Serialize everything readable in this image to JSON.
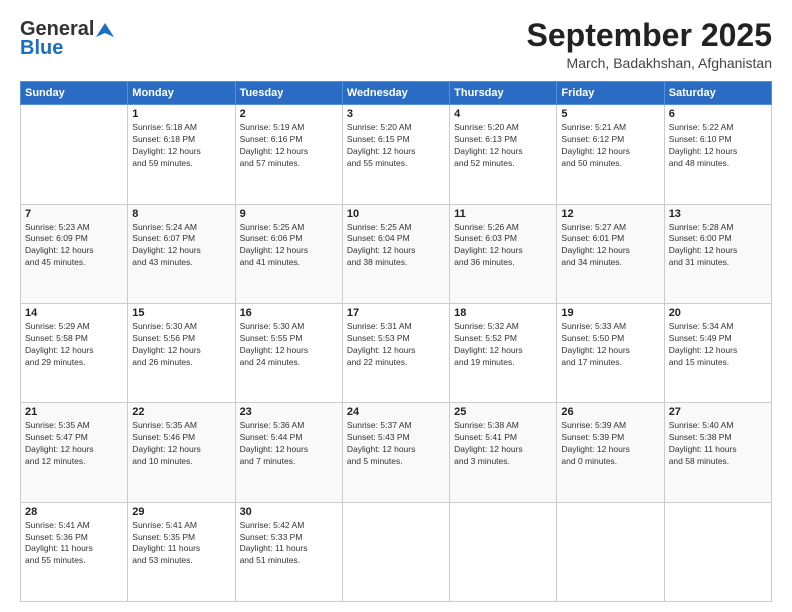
{
  "header": {
    "logo_general": "General",
    "logo_blue": "Blue",
    "month_title": "September 2025",
    "location": "March, Badakhshan, Afghanistan"
  },
  "weekdays": [
    "Sunday",
    "Monday",
    "Tuesday",
    "Wednesday",
    "Thursday",
    "Friday",
    "Saturday"
  ],
  "weeks": [
    [
      {
        "day": "",
        "info": ""
      },
      {
        "day": "1",
        "info": "Sunrise: 5:18 AM\nSunset: 6:18 PM\nDaylight: 12 hours\nand 59 minutes."
      },
      {
        "day": "2",
        "info": "Sunrise: 5:19 AM\nSunset: 6:16 PM\nDaylight: 12 hours\nand 57 minutes."
      },
      {
        "day": "3",
        "info": "Sunrise: 5:20 AM\nSunset: 6:15 PM\nDaylight: 12 hours\nand 55 minutes."
      },
      {
        "day": "4",
        "info": "Sunrise: 5:20 AM\nSunset: 6:13 PM\nDaylight: 12 hours\nand 52 minutes."
      },
      {
        "day": "5",
        "info": "Sunrise: 5:21 AM\nSunset: 6:12 PM\nDaylight: 12 hours\nand 50 minutes."
      },
      {
        "day": "6",
        "info": "Sunrise: 5:22 AM\nSunset: 6:10 PM\nDaylight: 12 hours\nand 48 minutes."
      }
    ],
    [
      {
        "day": "7",
        "info": "Sunrise: 5:23 AM\nSunset: 6:09 PM\nDaylight: 12 hours\nand 45 minutes."
      },
      {
        "day": "8",
        "info": "Sunrise: 5:24 AM\nSunset: 6:07 PM\nDaylight: 12 hours\nand 43 minutes."
      },
      {
        "day": "9",
        "info": "Sunrise: 5:25 AM\nSunset: 6:06 PM\nDaylight: 12 hours\nand 41 minutes."
      },
      {
        "day": "10",
        "info": "Sunrise: 5:25 AM\nSunset: 6:04 PM\nDaylight: 12 hours\nand 38 minutes."
      },
      {
        "day": "11",
        "info": "Sunrise: 5:26 AM\nSunset: 6:03 PM\nDaylight: 12 hours\nand 36 minutes."
      },
      {
        "day": "12",
        "info": "Sunrise: 5:27 AM\nSunset: 6:01 PM\nDaylight: 12 hours\nand 34 minutes."
      },
      {
        "day": "13",
        "info": "Sunrise: 5:28 AM\nSunset: 6:00 PM\nDaylight: 12 hours\nand 31 minutes."
      }
    ],
    [
      {
        "day": "14",
        "info": "Sunrise: 5:29 AM\nSunset: 5:58 PM\nDaylight: 12 hours\nand 29 minutes."
      },
      {
        "day": "15",
        "info": "Sunrise: 5:30 AM\nSunset: 5:56 PM\nDaylight: 12 hours\nand 26 minutes."
      },
      {
        "day": "16",
        "info": "Sunrise: 5:30 AM\nSunset: 5:55 PM\nDaylight: 12 hours\nand 24 minutes."
      },
      {
        "day": "17",
        "info": "Sunrise: 5:31 AM\nSunset: 5:53 PM\nDaylight: 12 hours\nand 22 minutes."
      },
      {
        "day": "18",
        "info": "Sunrise: 5:32 AM\nSunset: 5:52 PM\nDaylight: 12 hours\nand 19 minutes."
      },
      {
        "day": "19",
        "info": "Sunrise: 5:33 AM\nSunset: 5:50 PM\nDaylight: 12 hours\nand 17 minutes."
      },
      {
        "day": "20",
        "info": "Sunrise: 5:34 AM\nSunset: 5:49 PM\nDaylight: 12 hours\nand 15 minutes."
      }
    ],
    [
      {
        "day": "21",
        "info": "Sunrise: 5:35 AM\nSunset: 5:47 PM\nDaylight: 12 hours\nand 12 minutes."
      },
      {
        "day": "22",
        "info": "Sunrise: 5:35 AM\nSunset: 5:46 PM\nDaylight: 12 hours\nand 10 minutes."
      },
      {
        "day": "23",
        "info": "Sunrise: 5:36 AM\nSunset: 5:44 PM\nDaylight: 12 hours\nand 7 minutes."
      },
      {
        "day": "24",
        "info": "Sunrise: 5:37 AM\nSunset: 5:43 PM\nDaylight: 12 hours\nand 5 minutes."
      },
      {
        "day": "25",
        "info": "Sunrise: 5:38 AM\nSunset: 5:41 PM\nDaylight: 12 hours\nand 3 minutes."
      },
      {
        "day": "26",
        "info": "Sunrise: 5:39 AM\nSunset: 5:39 PM\nDaylight: 12 hours\nand 0 minutes."
      },
      {
        "day": "27",
        "info": "Sunrise: 5:40 AM\nSunset: 5:38 PM\nDaylight: 11 hours\nand 58 minutes."
      }
    ],
    [
      {
        "day": "28",
        "info": "Sunrise: 5:41 AM\nSunset: 5:36 PM\nDaylight: 11 hours\nand 55 minutes."
      },
      {
        "day": "29",
        "info": "Sunrise: 5:41 AM\nSunset: 5:35 PM\nDaylight: 11 hours\nand 53 minutes."
      },
      {
        "day": "30",
        "info": "Sunrise: 5:42 AM\nSunset: 5:33 PM\nDaylight: 11 hours\nand 51 minutes."
      },
      {
        "day": "",
        "info": ""
      },
      {
        "day": "",
        "info": ""
      },
      {
        "day": "",
        "info": ""
      },
      {
        "day": "",
        "info": ""
      }
    ]
  ]
}
